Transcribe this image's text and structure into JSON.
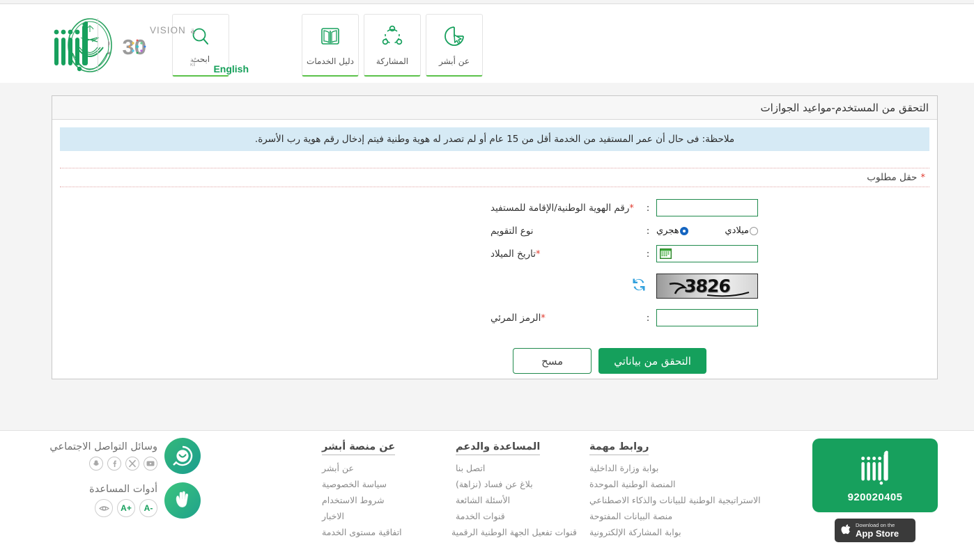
{
  "header": {
    "search_label": "ابحث",
    "search_icon": "search-icon",
    "english_link": "English",
    "nav_buttons": [
      {
        "label": "دليل الخدمات",
        "icon": "book-icon"
      },
      {
        "label": "المشاركة",
        "icon": "share-network-icon"
      },
      {
        "label": "عن أبشر",
        "icon": "pie-cursor-icon"
      }
    ],
    "vision_logo": {
      "word_vision": "VISION",
      "word_ruya": "رؤيــــة",
      "year": "2030",
      "kingdom_ar": "المملكة العربية السعودية",
      "kingdom_en": "KINGDOM OF SAUDI ARABIA"
    },
    "emblem_icon": "saudi-ministry-interior-emblem",
    "absher_logo_icon": "absher-logo"
  },
  "panel": {
    "title": "التحقق من المستخدم-مواعيد الجوازات",
    "notice": "ملاحظة: فى حال أن عمر المستفيد من الخدمة أقل من 15 عام أو لم تصدر له هوية وطنية فيتم إدخال رقم هوية رب الأسرة.",
    "required_hint": "حقل مطلوب",
    "required_star": "*",
    "colon": ":"
  },
  "form": {
    "fields": [
      {
        "label": "رقم الهوية الوطنية/الإقامة للمستفيد",
        "required": true,
        "type": "text",
        "value": "",
        "placeholder": ""
      },
      {
        "label": "نوع التقويم",
        "required": false,
        "type": "radio",
        "options": [
          {
            "label": "هجري",
            "selected": true
          },
          {
            "label": "ميلادي",
            "selected": false
          }
        ]
      },
      {
        "label": "تاريخ الميلاد",
        "required": true,
        "type": "date",
        "value": "",
        "placeholder": "",
        "icon": "calendar-icon"
      },
      {
        "label": "الرمز المرئي",
        "required": true,
        "type": "text",
        "value": "",
        "placeholder": ""
      }
    ],
    "captcha": {
      "text": "3826",
      "refresh_icon": "refresh-icon"
    },
    "buttons": {
      "submit": "التحقق من بياناتي",
      "reset": "مسح"
    }
  },
  "footer": {
    "card": {
      "phone": "920020405",
      "logo_icon": "absher-logo"
    },
    "appstore": {
      "line1": "Download on the",
      "line2": "App Store",
      "icon": "apple-icon"
    },
    "columns": [
      {
        "title": "عن منصة أبشر",
        "links": [
          "عن أبشر",
          "سياسة الخصوصية",
          "شروط الاستخدام",
          "الاخبار",
          "اتفاقية مستوى الخدمة"
        ]
      },
      {
        "title": "المساعدة والدعم",
        "links": [
          "اتصل بنا",
          "بلاغ عن فساد (نزاهة)",
          "الأسئلة الشائعة",
          "قنوات الخدمة",
          "قنوات تفعيل الجهة الوطنية الرقمية"
        ]
      },
      {
        "title": "روابط مهمة",
        "links": [
          "بوابة وزارة الداخلية",
          "المنصة الوطنية الموحدة",
          "الاستراتيجية الوطنية للبيانات والذكاء الاصطناعي",
          "منصة البيانات المفتوحة",
          "بوابة المشاركة الإلكترونية"
        ]
      }
    ],
    "social": {
      "title": "وسائل التواصل الاجتماعي",
      "icons": [
        "snapchat-icon",
        "facebook-icon",
        "x-twitter-icon",
        "youtube-icon"
      ],
      "avatar_icon": "chat-smile-icon"
    },
    "accessibility": {
      "title": "أدوات المساعدة",
      "icons": [
        "eye-icon",
        "increase-font-icon",
        "decrease-font-icon"
      ],
      "labels": [
        "",
        "+A",
        "-A"
      ],
      "avatar_icon": "sign-language-hands-icon"
    }
  },
  "colors": {
    "brand_green": "#17a05d",
    "accent_light_green": "#5bc24a",
    "notice_bg": "#d6eaf5",
    "input_border": "#1f8a4c",
    "required_red": "#e03b2f",
    "radio_blue": "#1565c0"
  }
}
